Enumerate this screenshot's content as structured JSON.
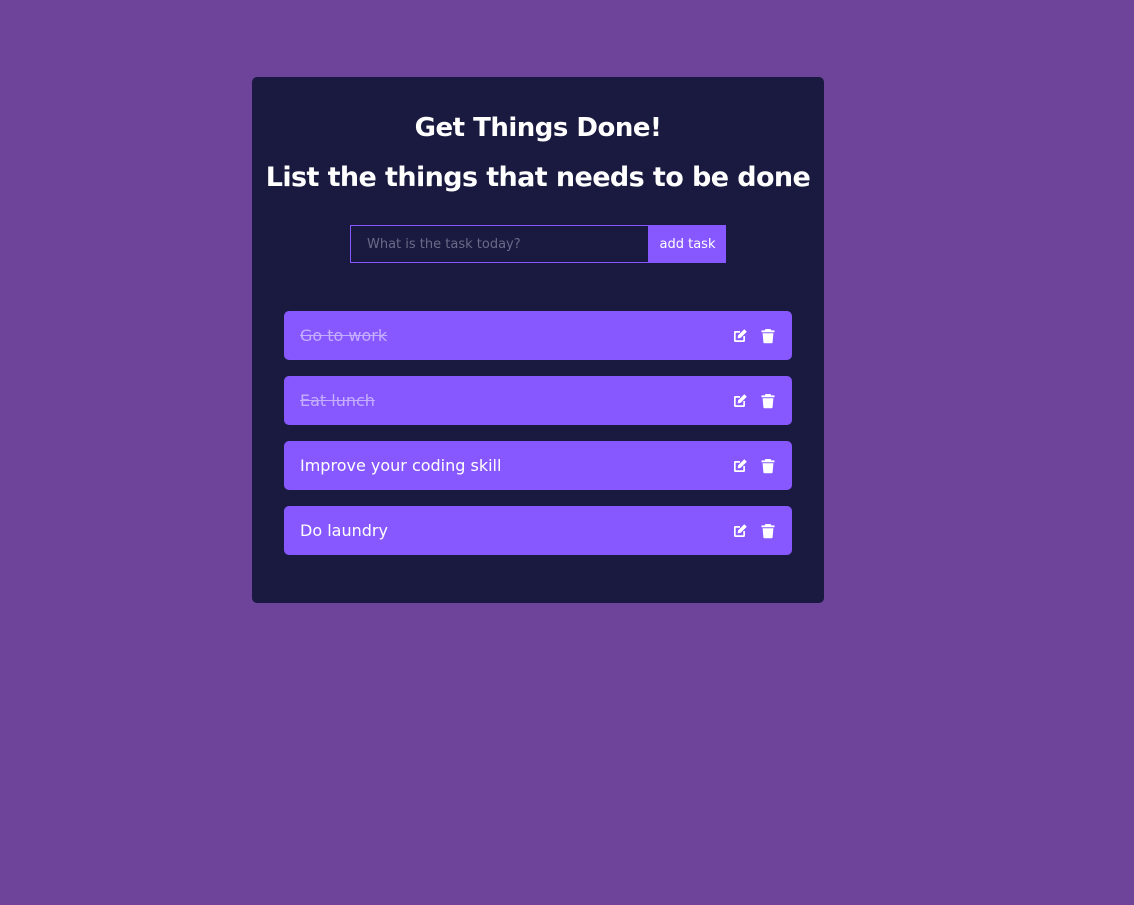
{
  "header": {
    "title": "Get Things Done!",
    "subtitle": "List the things that needs to be done"
  },
  "form": {
    "placeholder": "What is the task today?",
    "value": "",
    "add_label": "add task"
  },
  "todos": [
    {
      "text": "Go to work",
      "completed": true,
      "edit_icon": "pen-to-square-icon",
      "delete_icon": "trash-icon"
    },
    {
      "text": "Eat lunch",
      "completed": true,
      "edit_icon": "pen-to-square-icon",
      "delete_icon": "trash-icon"
    },
    {
      "text": "Improve your coding skill",
      "completed": false,
      "edit_icon": "pen-to-square-icon",
      "delete_icon": "trash-icon"
    },
    {
      "text": "Do laundry",
      "completed": false,
      "edit_icon": "pen-to-square-icon",
      "delete_icon": "trash-icon"
    }
  ],
  "colors": {
    "page_background": "#6e449b",
    "card_background": "#1a1a40",
    "accent": "#8758ff",
    "completed_text": "#c5aeff",
    "text": "#ffffff"
  }
}
